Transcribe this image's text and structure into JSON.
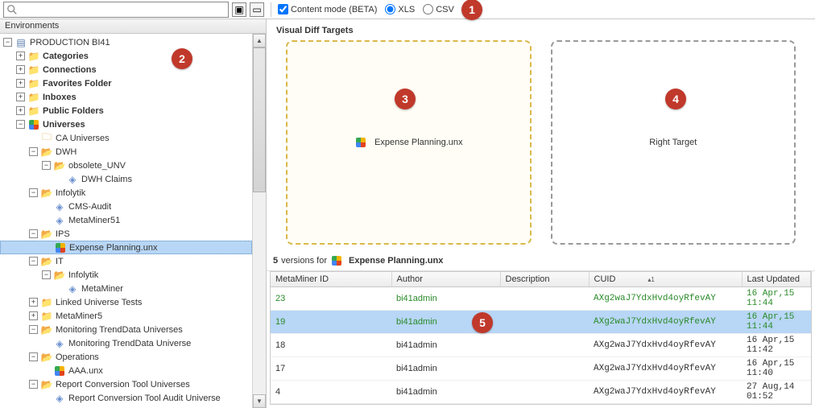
{
  "toolbar": {
    "search_placeholder": "",
    "content_mode_label": "Content mode (BETA)",
    "content_mode_checked": true,
    "fmt_xls": "XLS",
    "fmt_csv": "CSV",
    "fmt_selected": "XLS"
  },
  "sidebar": {
    "header": "Environments",
    "root": "PRODUCTION BI41",
    "nodes": {
      "categories": "Categories",
      "connections": "Connections",
      "favorites": "Favorites Folder",
      "inboxes": "Inboxes",
      "public_folders": "Public Folders",
      "universes": "Universes",
      "ca_universes": "CA Universes",
      "dwh": "DWH",
      "obsolete_unv": "obsolete_UNV",
      "dwh_claims": "DWH Claims",
      "infolytik": "Infolytik",
      "cms_audit": "CMS-Audit",
      "metaminer51": "MetaMiner51",
      "ips": "IPS",
      "expense_planning": "Expense Planning.unx",
      "it": "IT",
      "infolytik2": "Infolytik",
      "metaminer": "MetaMiner",
      "linked_univ_tests": "Linked Universe Tests",
      "metaminer5": "MetaMiner5",
      "monitoring_trend": "Monitoring TrendData Universes",
      "monitoring_trend_univ": "Monitoring TrendData Universe",
      "operations": "Operations",
      "aaa_unx": "AAA.unx",
      "report_conv": "Report Conversion Tool Universes",
      "report_conv_audit": "Report Conversion Tool Audit Universe"
    }
  },
  "diff": {
    "header": "Visual Diff Targets",
    "left_label": "Expense Planning.unx",
    "right_label": "Right Target"
  },
  "versions": {
    "count": "5",
    "label_prefix": "versions for",
    "file": "Expense Planning.unx",
    "columns": {
      "id": "MetaMiner ID",
      "author": "Author",
      "desc": "Description",
      "cuid": "CUID",
      "updated": "Last Updated"
    },
    "rows": [
      {
        "id": "23",
        "author": "bi41admin",
        "desc": "",
        "cuid": "AXg2waJ7YdxHvd4oyRfevAY",
        "updated": "16 Apr,15 11:44",
        "cls": "green"
      },
      {
        "id": "19",
        "author": "bi41admin",
        "desc": "",
        "cuid": "AXg2waJ7YdxHvd4oyRfevAY",
        "updated": "16 Apr,15 11:44",
        "cls": "green sel"
      },
      {
        "id": "18",
        "author": "bi41admin",
        "desc": "",
        "cuid": "AXg2waJ7YdxHvd4oyRfevAY",
        "updated": "16 Apr,15 11:42",
        "cls": ""
      },
      {
        "id": "17",
        "author": "bi41admin",
        "desc": "",
        "cuid": "AXg2waJ7YdxHvd4oyRfevAY",
        "updated": "16 Apr,15 11:40",
        "cls": ""
      },
      {
        "id": "4",
        "author": "bi41admin",
        "desc": "",
        "cuid": "AXg2waJ7YdxHvd4oyRfevAY",
        "updated": "27 Aug,14 01:52",
        "cls": ""
      }
    ]
  },
  "callouts": {
    "c1": "1",
    "c2": "2",
    "c3": "3",
    "c4": "4",
    "c5": "5"
  }
}
